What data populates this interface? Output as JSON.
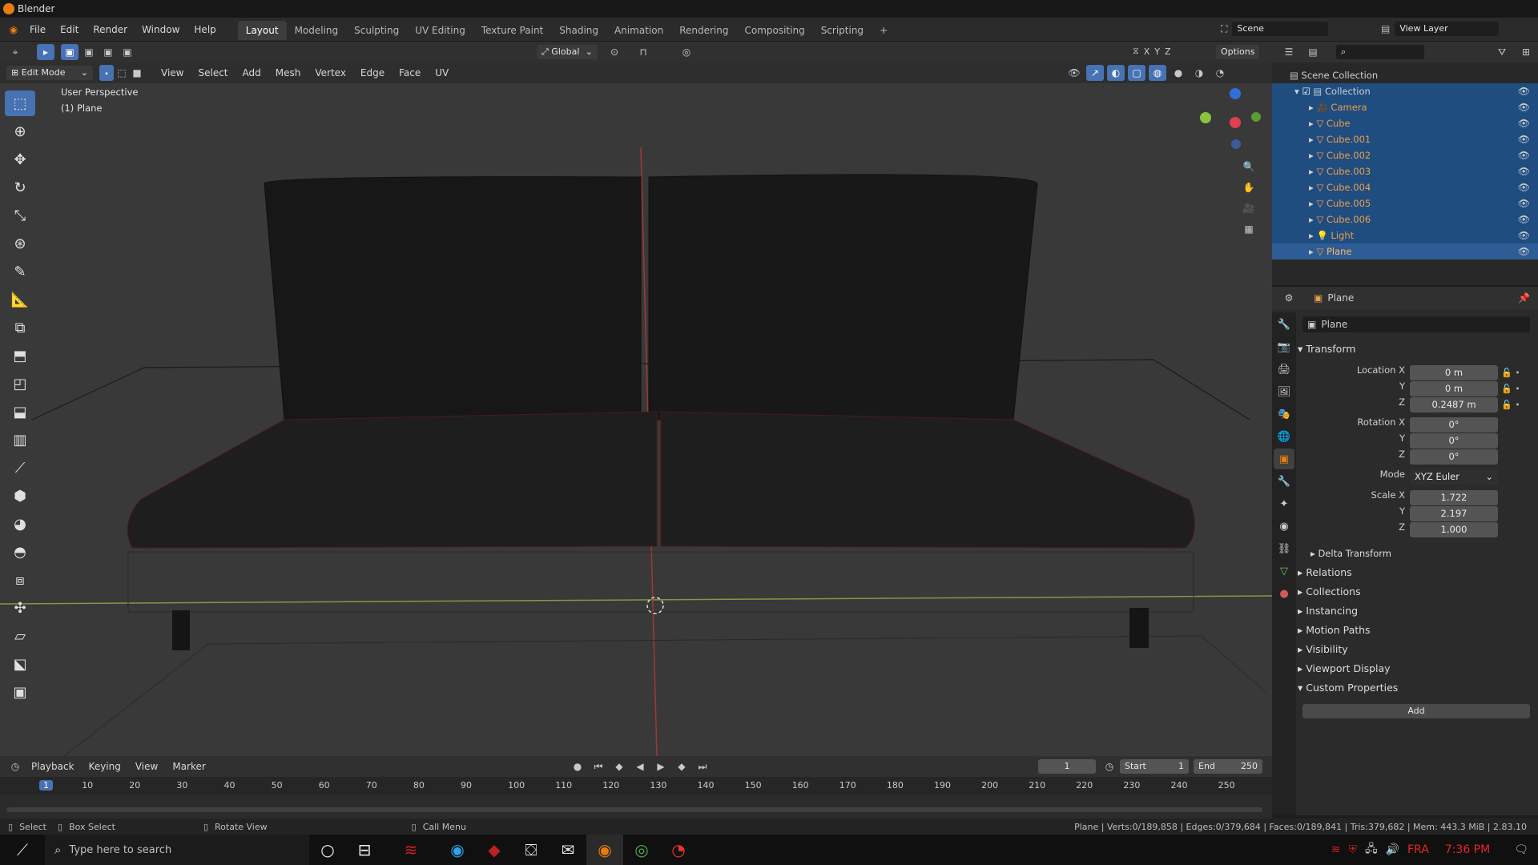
{
  "window": {
    "title": "Blender"
  },
  "menubar": {
    "items": [
      "File",
      "Edit",
      "Render",
      "Window",
      "Help"
    ],
    "workspaces": [
      "Layout",
      "Modeling",
      "Sculpting",
      "UV Editing",
      "Texture Paint",
      "Shading",
      "Animation",
      "Rendering",
      "Compositing",
      "Scripting"
    ],
    "add_workspace": "+",
    "scene_label": "Scene",
    "view_layer_label": "View Layer"
  },
  "viewport_header": {
    "mode": "Edit Mode",
    "menus": [
      "View",
      "Select",
      "Add",
      "Mesh",
      "Vertex",
      "Edge",
      "Face",
      "UV"
    ],
    "orientation": "Global",
    "options": "Options",
    "axes": [
      "X",
      "Y",
      "Z"
    ]
  },
  "viewport": {
    "perspective": "User Perspective",
    "object": "(1) Plane"
  },
  "outliner": {
    "root": "Scene Collection",
    "collection": "Collection",
    "objects": [
      {
        "name": "Camera",
        "type": "camera"
      },
      {
        "name": "Cube",
        "type": "mesh"
      },
      {
        "name": "Cube.001",
        "type": "mesh"
      },
      {
        "name": "Cube.002",
        "type": "mesh"
      },
      {
        "name": "Cube.003",
        "type": "mesh"
      },
      {
        "name": "Cube.004",
        "type": "mesh"
      },
      {
        "name": "Cube.005",
        "type": "mesh"
      },
      {
        "name": "Cube.006",
        "type": "mesh"
      },
      {
        "name": "Light",
        "type": "light"
      },
      {
        "name": "Plane",
        "type": "mesh"
      }
    ]
  },
  "properties": {
    "header_object": "Plane",
    "object_name": "Plane",
    "transform_title": "Transform",
    "location_label": "Location X",
    "location": [
      "0 m",
      "0 m",
      "0.2487 m"
    ],
    "rotation_label": "Rotation X",
    "rotation": [
      "0°",
      "0°",
      "0°"
    ],
    "mode_label": "Mode",
    "mode_value": "XYZ Euler",
    "scale_label": "Scale X",
    "scale": [
      "1.722",
      "2.197",
      "1.000"
    ],
    "y_label": "Y",
    "z_label": "Z",
    "delta": "Delta Transform",
    "panels": [
      "Relations",
      "Collections",
      "Instancing",
      "Motion Paths",
      "Visibility",
      "Viewport Display"
    ],
    "custom_props": "Custom Properties",
    "add_button": "Add"
  },
  "timeline": {
    "menus": [
      "Playback",
      "Keying",
      "View",
      "Marker"
    ],
    "current_frame": "1",
    "start_label": "Start",
    "start": "1",
    "end_label": "End",
    "end": "250",
    "ticks": [
      "1",
      "10",
      "20",
      "30",
      "40",
      "50",
      "60",
      "70",
      "80",
      "90",
      "100",
      "110",
      "120",
      "130",
      "140",
      "150",
      "160",
      "170",
      "180",
      "190",
      "200",
      "210",
      "220",
      "230",
      "240",
      "250"
    ]
  },
  "statusbar": {
    "select": "Select",
    "box_select": "Box Select",
    "rotate_view": "Rotate View",
    "call_menu": "Call Menu",
    "stats": "Plane | Verts:0/189,858 | Edges:0/379,684 | Faces:0/189,841 | Tris:379,682 | Mem: 443.3 MiB | 2.83.10"
  },
  "taskbar": {
    "search_placeholder": "Type here to search",
    "lang": "FRA",
    "time": "7:36 PM"
  },
  "colors": {
    "accent": "#4772b3",
    "selected_row": "#1f4d80",
    "orange": "#e87d0d",
    "mesh_icon": "#e8a04a",
    "green": "#6bc26b"
  }
}
